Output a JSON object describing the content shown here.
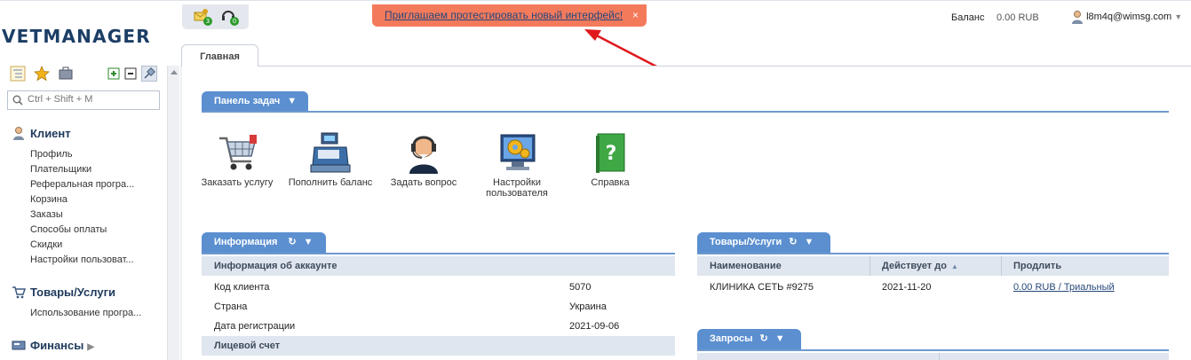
{
  "app": {
    "logo": "VETMANAGER"
  },
  "header": {
    "notifications": [
      {
        "icon": "envelope-key-icon",
        "count": "3"
      },
      {
        "icon": "headset-icon",
        "count": "0"
      }
    ],
    "banner": {
      "text": "Приглашаем протестировать новый интерфейс!",
      "close": "×"
    },
    "balance_label": "Баланс",
    "balance_value": "0.00 RUB",
    "user": "l8m4q@wimsg.com"
  },
  "sidebar": {
    "search_placeholder": "Ctrl + Shift + M",
    "sections": [
      {
        "title": "Клиент",
        "icon": "client-icon",
        "items": [
          "Профиль",
          "Плательщики",
          "Реферальная програ...",
          "Корзина",
          "Заказы",
          "Способы оплаты",
          "Скидки",
          "Настройки пользоват..."
        ]
      },
      {
        "title": "Товары/Услуги",
        "icon": "cart-icon",
        "items": [
          "Использование програ..."
        ]
      },
      {
        "title": "Финансы",
        "icon": "finance-icon",
        "items": []
      }
    ]
  },
  "tabs": {
    "main": "Главная"
  },
  "taskbar": {
    "title": "Панель задач",
    "tiles": [
      {
        "label": "Заказать услугу",
        "icon": "shopping-cart-icon"
      },
      {
        "label": "Пополнить баланс",
        "icon": "cash-register-icon"
      },
      {
        "label": "Задать вопрос",
        "icon": "support-agent-icon"
      },
      {
        "label": "Настройки пользователя",
        "icon": "monitor-gear-icon"
      },
      {
        "label": "Справка",
        "icon": "help-book-icon"
      }
    ]
  },
  "info": {
    "title": "Информация",
    "section1": "Информация об аккаунте",
    "rows": [
      {
        "label": "Код клиента",
        "value": "5070"
      },
      {
        "label": "Страна",
        "value": "Украина"
      },
      {
        "label": "Дата регистрации",
        "value": "2021-09-06"
      }
    ],
    "section2": "Лицевой счет"
  },
  "goods": {
    "title": "Товары/Услуги",
    "columns": [
      "Наименование",
      "Действует до",
      "Продлить"
    ],
    "rows": [
      {
        "name": "КЛИНИКА СЕТЬ #9275",
        "until": "2021-11-20",
        "renew": "0.00 RUB / Триальный"
      }
    ]
  },
  "requests": {
    "title": "Запросы"
  },
  "colors": {
    "accent": "#5b8fd0",
    "banner": "#f47a5c",
    "logo": "#1c3e66"
  }
}
